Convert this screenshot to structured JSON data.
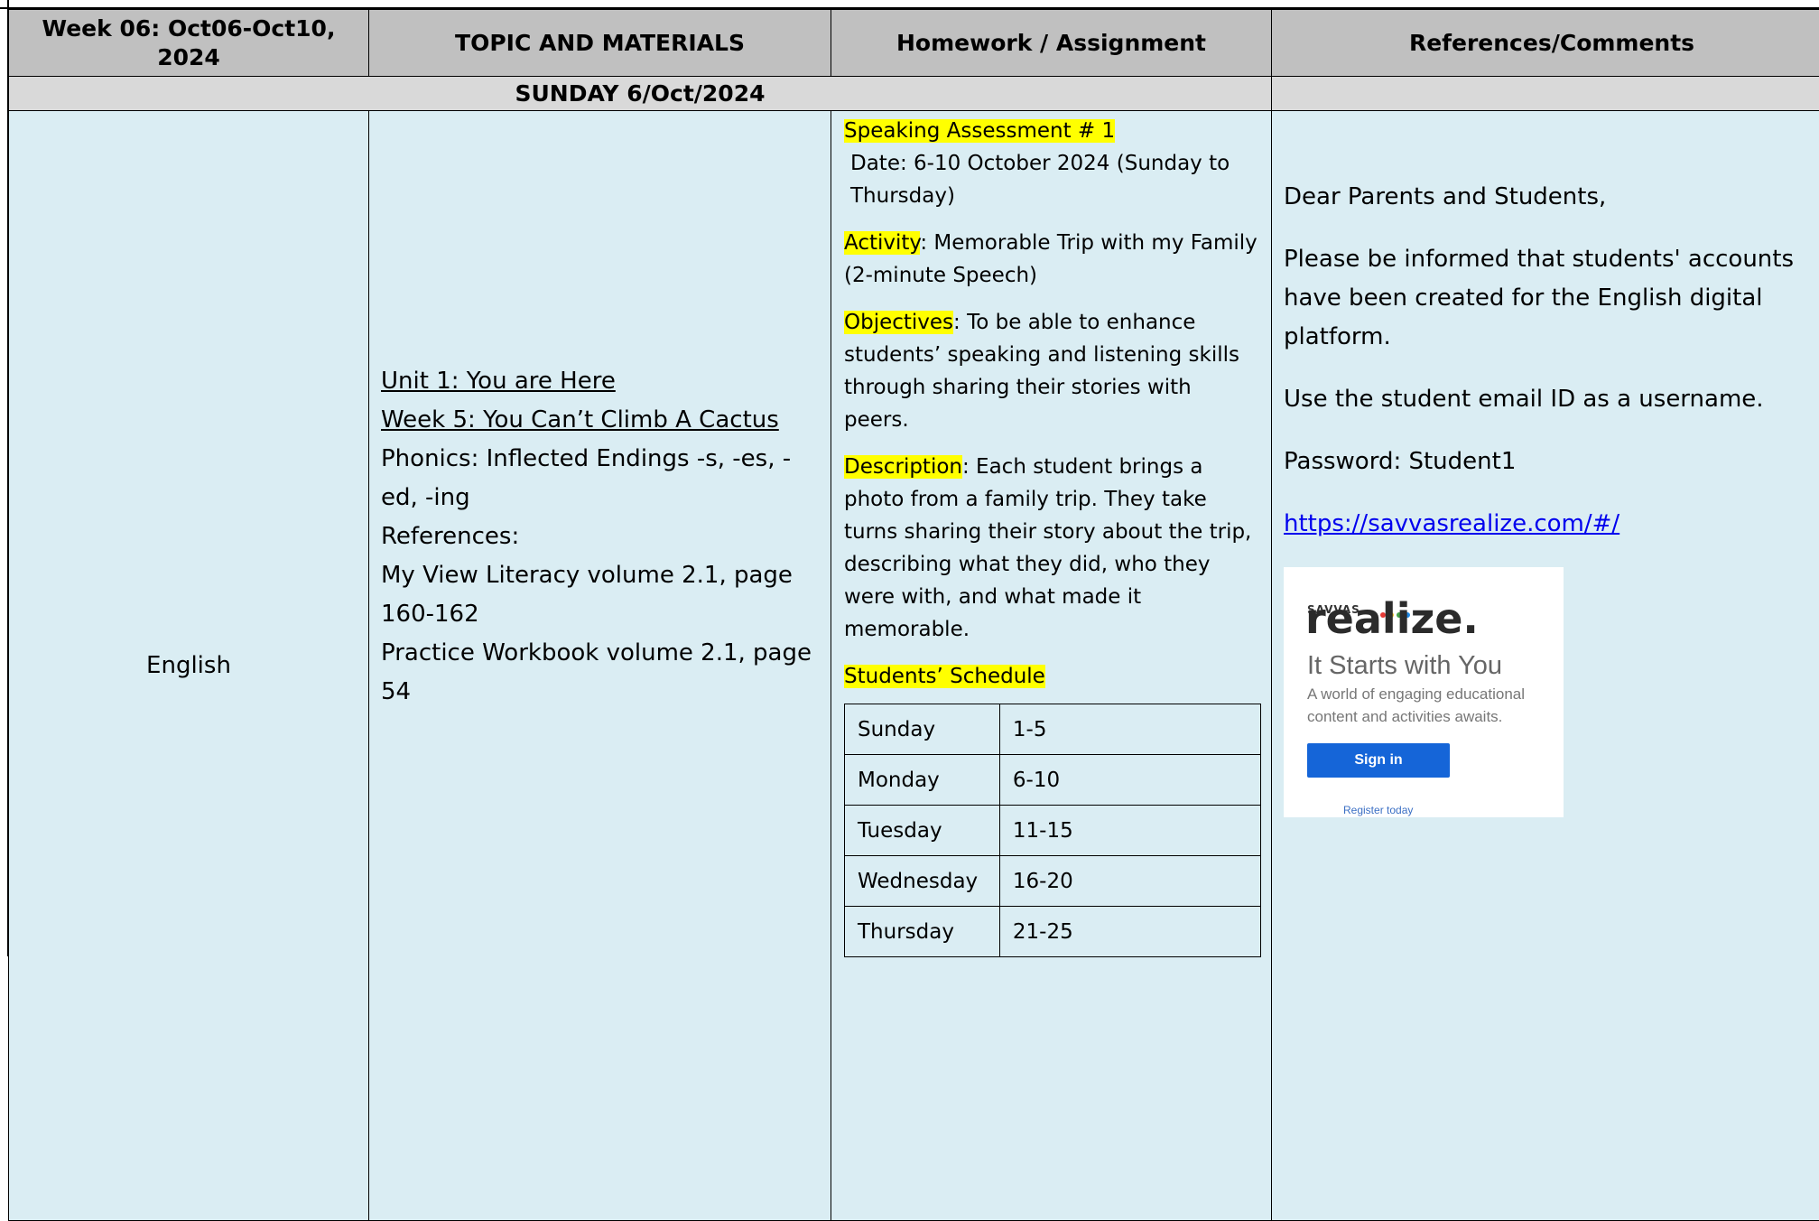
{
  "header": {
    "week": "Week 06: Oct06-Oct10, 2024",
    "topic": "TOPIC AND MATERIALS",
    "homework": "Homework / Assignment",
    "references": "References/Comments"
  },
  "day": "SUNDAY 6/Oct/2024",
  "subject": "English",
  "topic": {
    "unit": "Unit 1: You are Here",
    "week": "Week 5: You Can’t Climb A Cactus",
    "phonics": "Phonics: Inflected Endings -s, -es, -ed, -ing",
    "references_label": "References:",
    "ref1": "My View Literacy volume 2.1, page 160-162",
    "ref2": "Practice Workbook volume 2.1, page 54"
  },
  "homework": {
    "title": "Speaking Assessment # 1",
    "date": "Date: 6-10 October 2024 (Sunday to Thursday)",
    "activity_label": "Activity",
    "activity": ": Memorable Trip with my Family (2-minute Speech)",
    "objectives_label": "Objectives",
    "objectives": ": To be able to enhance students’ speaking and listening skills through sharing their stories with peers.",
    "description_label": "Description",
    "description": ": Each student brings a photo from a family trip. They take turns sharing their story about the trip, describing what they did, who they were with, and what made it memorable.",
    "schedule_label": "Students’ Schedule",
    "schedule": [
      {
        "day": "Sunday",
        "range": "1-5"
      },
      {
        "day": "Monday",
        "range": "6-10"
      },
      {
        "day": "Tuesday",
        "range": "11-15"
      },
      {
        "day": "Wednesday",
        "range": "16-20"
      },
      {
        "day": "Thursday",
        "range": "21-25"
      }
    ]
  },
  "comments": {
    "greeting": "Dear Parents and Students,",
    "info": "Please be informed that students' accounts have been created for the English digital platform.",
    "username": "Use the student email ID as a username.",
    "password": "Password: Student1",
    "link": "https://savvasrealize.com/#/"
  },
  "logo": {
    "brand_small": "SAVVAS",
    "brand": "realize.",
    "tagline": "It Starts with You",
    "subtitle": "A world of engaging educational content and activities awaits.",
    "signin": "Sign in",
    "register": "Register today",
    "dot_colors": [
      "#e53935",
      "#fbc02d",
      "#43a047",
      "#1e88e5"
    ]
  }
}
